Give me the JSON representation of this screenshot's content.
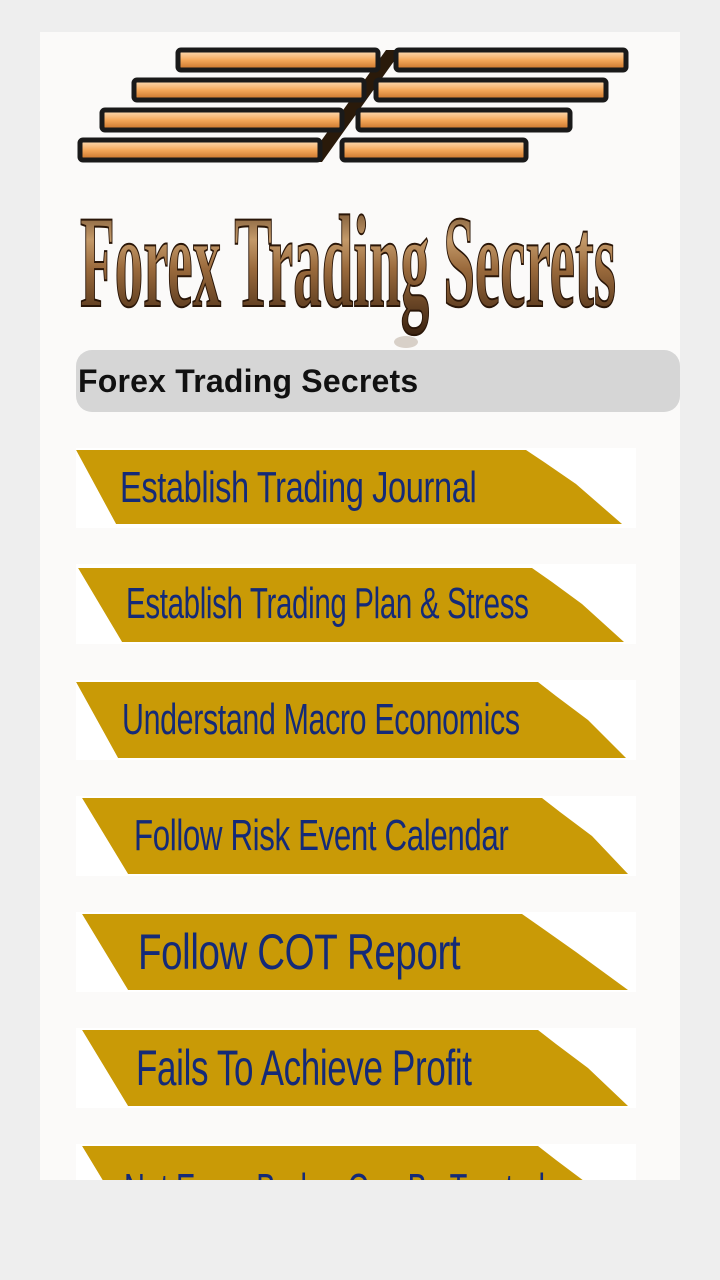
{
  "app": {
    "logo_text": "Forex Trading Secrets",
    "title": "Forex Trading Secrets"
  },
  "colors": {
    "banner_gold": "#c99a06",
    "banner_text": "#142a78",
    "title_bar_bg": "#d6d6d6",
    "logo_bronze": "#8a5a2b"
  },
  "menu": {
    "items": [
      {
        "label": "Establish Trading Journal"
      },
      {
        "label": "Establish Trading Plan & Stress"
      },
      {
        "label": "Understand Macro Economics"
      },
      {
        "label": "Follow Risk Event Calendar"
      },
      {
        "label": "Follow COT Report"
      },
      {
        "label": "Fails To Achieve Profit"
      },
      {
        "label": "Not Every Broker Can Be Trusted"
      }
    ]
  }
}
